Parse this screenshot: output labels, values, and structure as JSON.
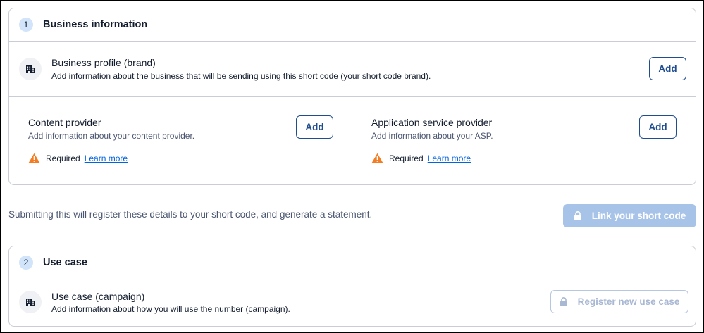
{
  "business_info": {
    "step": "1",
    "title": "Business information",
    "brand": {
      "title": "Business profile (brand)",
      "description": "Add information about the business that will be sending using this short code (your short code brand).",
      "add_label": "Add"
    },
    "content_provider": {
      "title": "Content provider",
      "description": "Add information about your content provider.",
      "add_label": "Add",
      "required_label": "Required",
      "learn_more": "Learn more"
    },
    "asp": {
      "title": "Application service provider",
      "description": "Add information about your ASP.",
      "add_label": "Add",
      "required_label": "Required",
      "learn_more": "Learn more"
    }
  },
  "submit": {
    "note": "Submitting this will register these details to your short code, and generate a statement.",
    "link_button": "Link your short code"
  },
  "use_case": {
    "step": "2",
    "title": "Use case",
    "campaign": {
      "title": "Use case (campaign)",
      "description": "Add information about how you will use the number (campaign).",
      "register_button": "Register new use case"
    }
  },
  "icons": {
    "building": "building-icon",
    "warning": "warning-icon",
    "lock": "lock-icon"
  },
  "colors": {
    "accent": "#1f4d8f",
    "link": "#0263e0",
    "warning": "#f47c22",
    "disabled_button": "#a8c3e8",
    "step_badge": "#d1e4fa"
  }
}
